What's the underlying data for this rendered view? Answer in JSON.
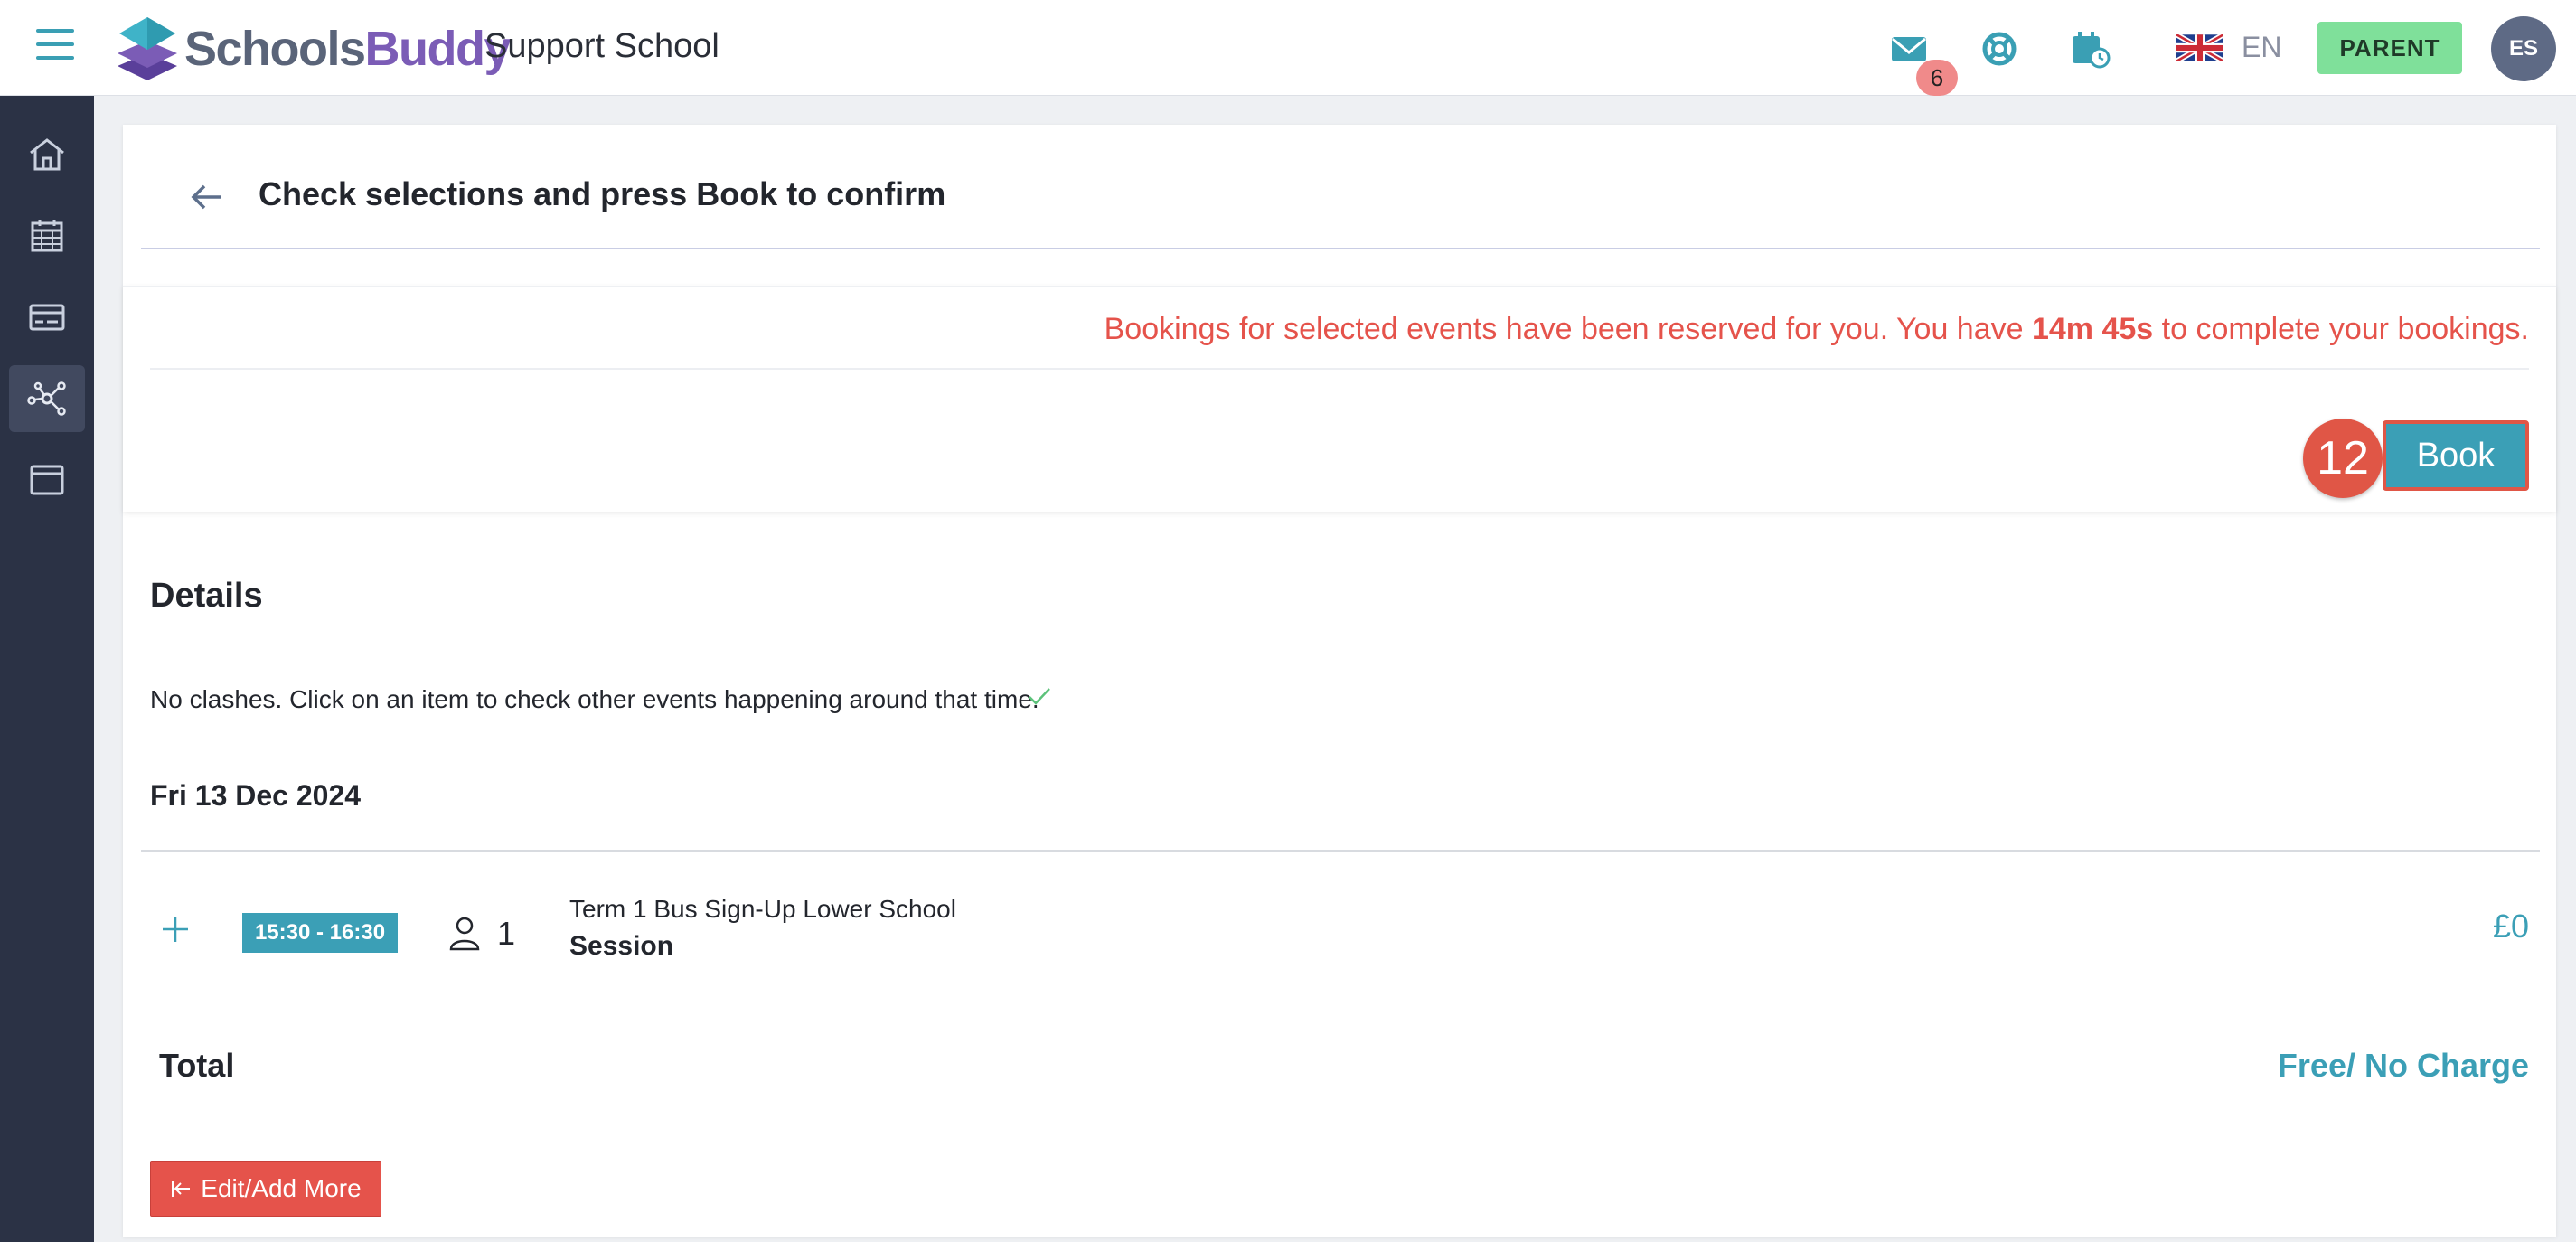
{
  "header": {
    "brand_part1": "Schools",
    "brand_part2": "Buddy",
    "school_name": "Support School",
    "mail_count": "6",
    "language": "EN",
    "role_button": "PARENT",
    "avatar_initials": "ES"
  },
  "sidebar": {
    "items": [
      {
        "icon": "home-icon",
        "active": false
      },
      {
        "icon": "calendar-icon",
        "active": false
      },
      {
        "icon": "payment-card-icon",
        "active": false
      },
      {
        "icon": "network-icon",
        "active": true
      },
      {
        "icon": "window-icon",
        "active": false
      }
    ]
  },
  "page": {
    "title": "Check selections and press Book to confirm"
  },
  "reservation": {
    "text_before": "Bookings for selected events have been reserved for you. You have ",
    "time_left": "14m 45s",
    "text_after": " to complete your bookings.",
    "step_number": "12",
    "book_label": "Book"
  },
  "details": {
    "title": "Details",
    "clash_message": "No clashes. Click on an item to check other events happening around that time.",
    "date": "Fri 13 Dec 2024",
    "events": [
      {
        "time": "15:30 - 16:30",
        "attendees": "1",
        "name": "Term 1 Bus Sign-Up Lower School",
        "type": "Session",
        "price": "£0"
      }
    ],
    "total_label": "Total",
    "total_value": "Free/ No Charge",
    "edit_label": "Edit/Add More"
  },
  "colors": {
    "accent": "#3b9fb6",
    "danger": "#e5534b",
    "sidebar": "#2b3245",
    "brand_purple": "#7b5cb6",
    "role_green": "#7fe09a"
  }
}
